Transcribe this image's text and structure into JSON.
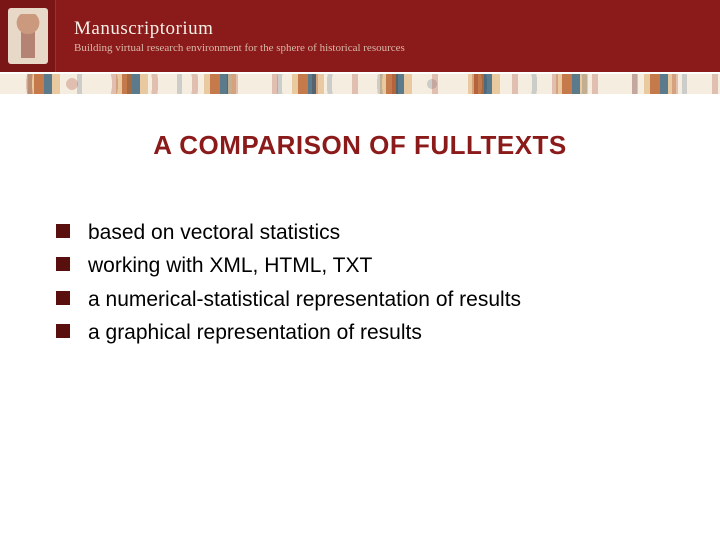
{
  "header": {
    "brand_title": "Manuscriptorium",
    "brand_subtitle": "Building virtual research environment for the sphere of historical resources"
  },
  "slide": {
    "title": "A COMPARISON OF FULLTEXTS",
    "bullets": [
      "based on vectoral statistics",
      "working with XML, HTML, TXT",
      "a numerical-statistical representation of results",
      "a graphical representation of results"
    ]
  },
  "colors": {
    "brand_red": "#8b1a1a",
    "bullet_dark": "#5a0f0f"
  }
}
